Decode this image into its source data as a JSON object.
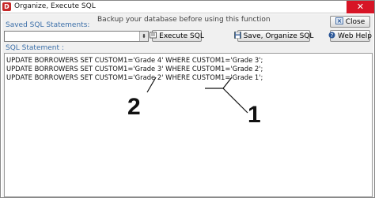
{
  "window": {
    "title": "Organize, Execute SQL",
    "app_icon_letter": "D",
    "close_glyph": "✕"
  },
  "toolbar": {
    "saved_label": "Saved SQL Statements:",
    "backup_notice": "Backup your database before using this function",
    "combo_value": "",
    "combo_arrow": "⬍",
    "execute_label": "Execute SQL",
    "save_organize_label": "Save, Organize SQL",
    "close_label": "Close",
    "help_label": "Web Help"
  },
  "editor": {
    "label": "SQL Statement :",
    "lines": [
      "UPDATE BORROWERS SET CUSTOM1='Grade 4' WHERE CUSTOM1='Grade 3';",
      "UPDATE BORROWERS SET CUSTOM1='Grade 3' WHERE CUSTOM1='Grade 2';",
      "UPDATE BORROWERS SET CUSTOM1='Grade 2' WHERE CUSTOM1='Grade 1';"
    ]
  },
  "annotations": {
    "marker_1": "1",
    "marker_2": "2"
  },
  "colors": {
    "label_blue": "#3a6ea8",
    "close_red": "#d71526"
  },
  "icons": {
    "execute": "execute-icon",
    "save": "save-icon",
    "close": "close-icon",
    "help": "help-icon"
  }
}
